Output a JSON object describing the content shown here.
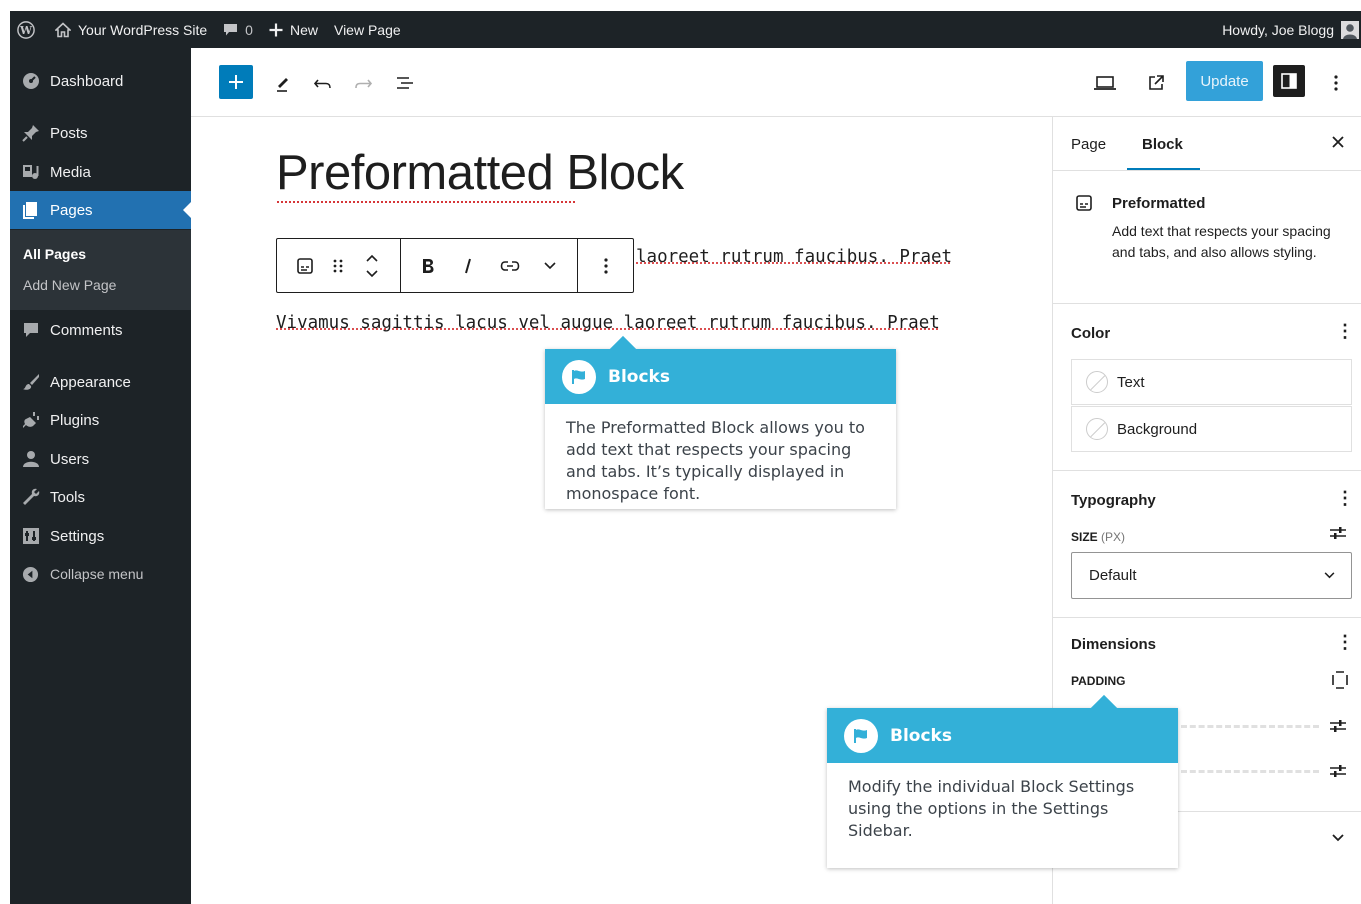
{
  "admin_bar": {
    "site_name": "Your WordPress Site",
    "comments_count": "0",
    "new_label": "New",
    "view_page_label": "View Page",
    "greeting": "Howdy, Joe Blogg"
  },
  "sidebar": {
    "items": [
      {
        "label": "Dashboard",
        "icon": "dashboard-icon"
      },
      {
        "label": "Posts",
        "icon": "pin-icon"
      },
      {
        "label": "Media",
        "icon": "media-icon"
      },
      {
        "label": "Pages",
        "icon": "pages-icon"
      },
      {
        "label": "Comments",
        "icon": "comment-icon"
      },
      {
        "label": "Appearance",
        "icon": "brush-icon"
      },
      {
        "label": "Plugins",
        "icon": "plug-icon"
      },
      {
        "label": "Users",
        "icon": "users-icon"
      },
      {
        "label": "Tools",
        "icon": "wrench-icon"
      },
      {
        "label": "Settings",
        "icon": "settings-icon"
      },
      {
        "label": "Collapse menu",
        "icon": "collapse-icon"
      }
    ],
    "submenu": [
      "All Pages",
      "Add New Page"
    ]
  },
  "toolbar": {
    "update_label": "Update"
  },
  "editor": {
    "title": "Preformatted Block",
    "line1_visible": "laoreet rutrum faucibus. Praet",
    "line2": "Vivamus sagittis lacus vel augue laoreet rutrum faucibus. Praet"
  },
  "callouts": [
    {
      "title": "Blocks",
      "text": "The Preformatted Block allows you to add text that respects your spacing and tabs. It’s typically displayed in monospace font."
    },
    {
      "title": "Blocks",
      "text": "Modify the individual Block Settings using the options in the Settings Sidebar."
    }
  ],
  "inspector": {
    "tabs": [
      "Page",
      "Block"
    ],
    "active_tab": "Block",
    "block_name": "Preformatted",
    "block_description": "Add text that respects your spacing and tabs, and also allows styling.",
    "color": {
      "title": "Color",
      "options": [
        "Text",
        "Background"
      ]
    },
    "typography": {
      "title": "Typography",
      "size_label": "SIZE",
      "size_unit": "(PX)",
      "size_value": "Default"
    },
    "dimensions": {
      "title": "Dimensions",
      "padding_label": "PADDING"
    }
  },
  "colors": {
    "admin_dark": "#1d2327",
    "accent": "#2271b1",
    "callout": "#33b0d8",
    "update_button": "#33a1d9"
  }
}
